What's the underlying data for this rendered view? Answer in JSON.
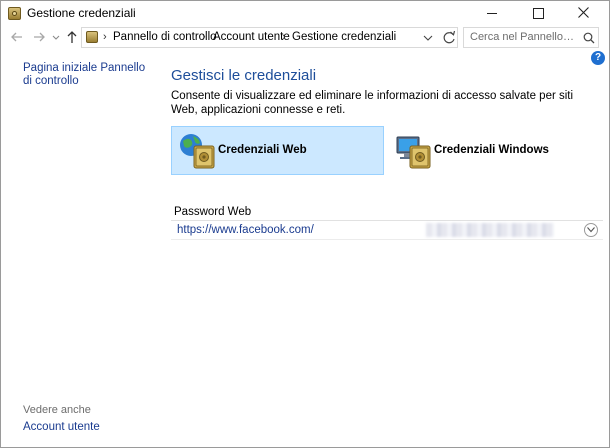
{
  "window": {
    "title": "Gestione credenziali"
  },
  "address": {
    "crumbs": [
      "Pannello di controllo",
      "Account utente",
      "Gestione credenziali"
    ],
    "search_placeholder": "Cerca nel Pannello di controllo"
  },
  "left_panel": {
    "home_link": "Pagina iniziale Pannello di controllo",
    "see_also": "Vedere anche",
    "accounts_link": "Account utente"
  },
  "main": {
    "title": "Gestisci le credenziali",
    "description": "Consente di visualizzare ed eliminare le informazioni di accesso salvate per siti Web, applicazioni connesse e reti.",
    "tiles": [
      {
        "label": "Credenziali Web",
        "icon": "globe-vault-icon",
        "selected": true
      },
      {
        "label": "Credenziali Windows",
        "icon": "computer-vault-icon",
        "selected": false
      }
    ],
    "section_title": "Password Web",
    "credentials": [
      {
        "url": "https://www.facebook.com/"
      }
    ]
  },
  "colors": {
    "accent_title": "#1e4e9a",
    "link": "#1a3b8f",
    "selected_tile": "#cce8ff",
    "help": "#1f6fd0"
  }
}
